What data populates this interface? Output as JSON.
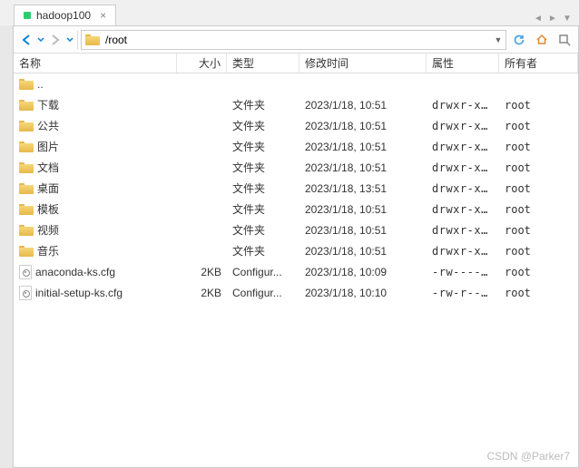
{
  "tab": {
    "title": "hadoop100"
  },
  "nav": {
    "path": "/root"
  },
  "columns": {
    "name": "名称",
    "size": "大小",
    "type": "类型",
    "mtime": "修改时间",
    "perm": "属性",
    "owner": "所有者"
  },
  "items": [
    {
      "name": "..",
      "size": "",
      "type": "",
      "mtime": "",
      "perm": "",
      "owner": "",
      "icon": "folder"
    },
    {
      "name": "下载",
      "size": "",
      "type": "文件夹",
      "mtime": "2023/1/18, 10:51",
      "perm": "drwxr-xr...",
      "owner": "root",
      "icon": "folder"
    },
    {
      "name": "公共",
      "size": "",
      "type": "文件夹",
      "mtime": "2023/1/18, 10:51",
      "perm": "drwxr-xr...",
      "owner": "root",
      "icon": "folder"
    },
    {
      "name": "图片",
      "size": "",
      "type": "文件夹",
      "mtime": "2023/1/18, 10:51",
      "perm": "drwxr-xr...",
      "owner": "root",
      "icon": "folder"
    },
    {
      "name": "文档",
      "size": "",
      "type": "文件夹",
      "mtime": "2023/1/18, 10:51",
      "perm": "drwxr-xr...",
      "owner": "root",
      "icon": "folder"
    },
    {
      "name": "桌面",
      "size": "",
      "type": "文件夹",
      "mtime": "2023/1/18, 13:51",
      "perm": "drwxr-xr...",
      "owner": "root",
      "icon": "folder"
    },
    {
      "name": "模板",
      "size": "",
      "type": "文件夹",
      "mtime": "2023/1/18, 10:51",
      "perm": "drwxr-xr...",
      "owner": "root",
      "icon": "folder"
    },
    {
      "name": "视频",
      "size": "",
      "type": "文件夹",
      "mtime": "2023/1/18, 10:51",
      "perm": "drwxr-xr...",
      "owner": "root",
      "icon": "folder"
    },
    {
      "name": "音乐",
      "size": "",
      "type": "文件夹",
      "mtime": "2023/1/18, 10:51",
      "perm": "drwxr-xr...",
      "owner": "root",
      "icon": "folder"
    },
    {
      "name": "anaconda-ks.cfg",
      "size": "2KB",
      "type": "Configur...",
      "mtime": "2023/1/18, 10:09",
      "perm": "-rw-----...",
      "owner": "root",
      "icon": "file"
    },
    {
      "name": "initial-setup-ks.cfg",
      "size": "2KB",
      "type": "Configur...",
      "mtime": "2023/1/18, 10:10",
      "perm": "-rw-r--r...",
      "owner": "root",
      "icon": "file"
    }
  ],
  "watermark": "CSDN @Parker7"
}
